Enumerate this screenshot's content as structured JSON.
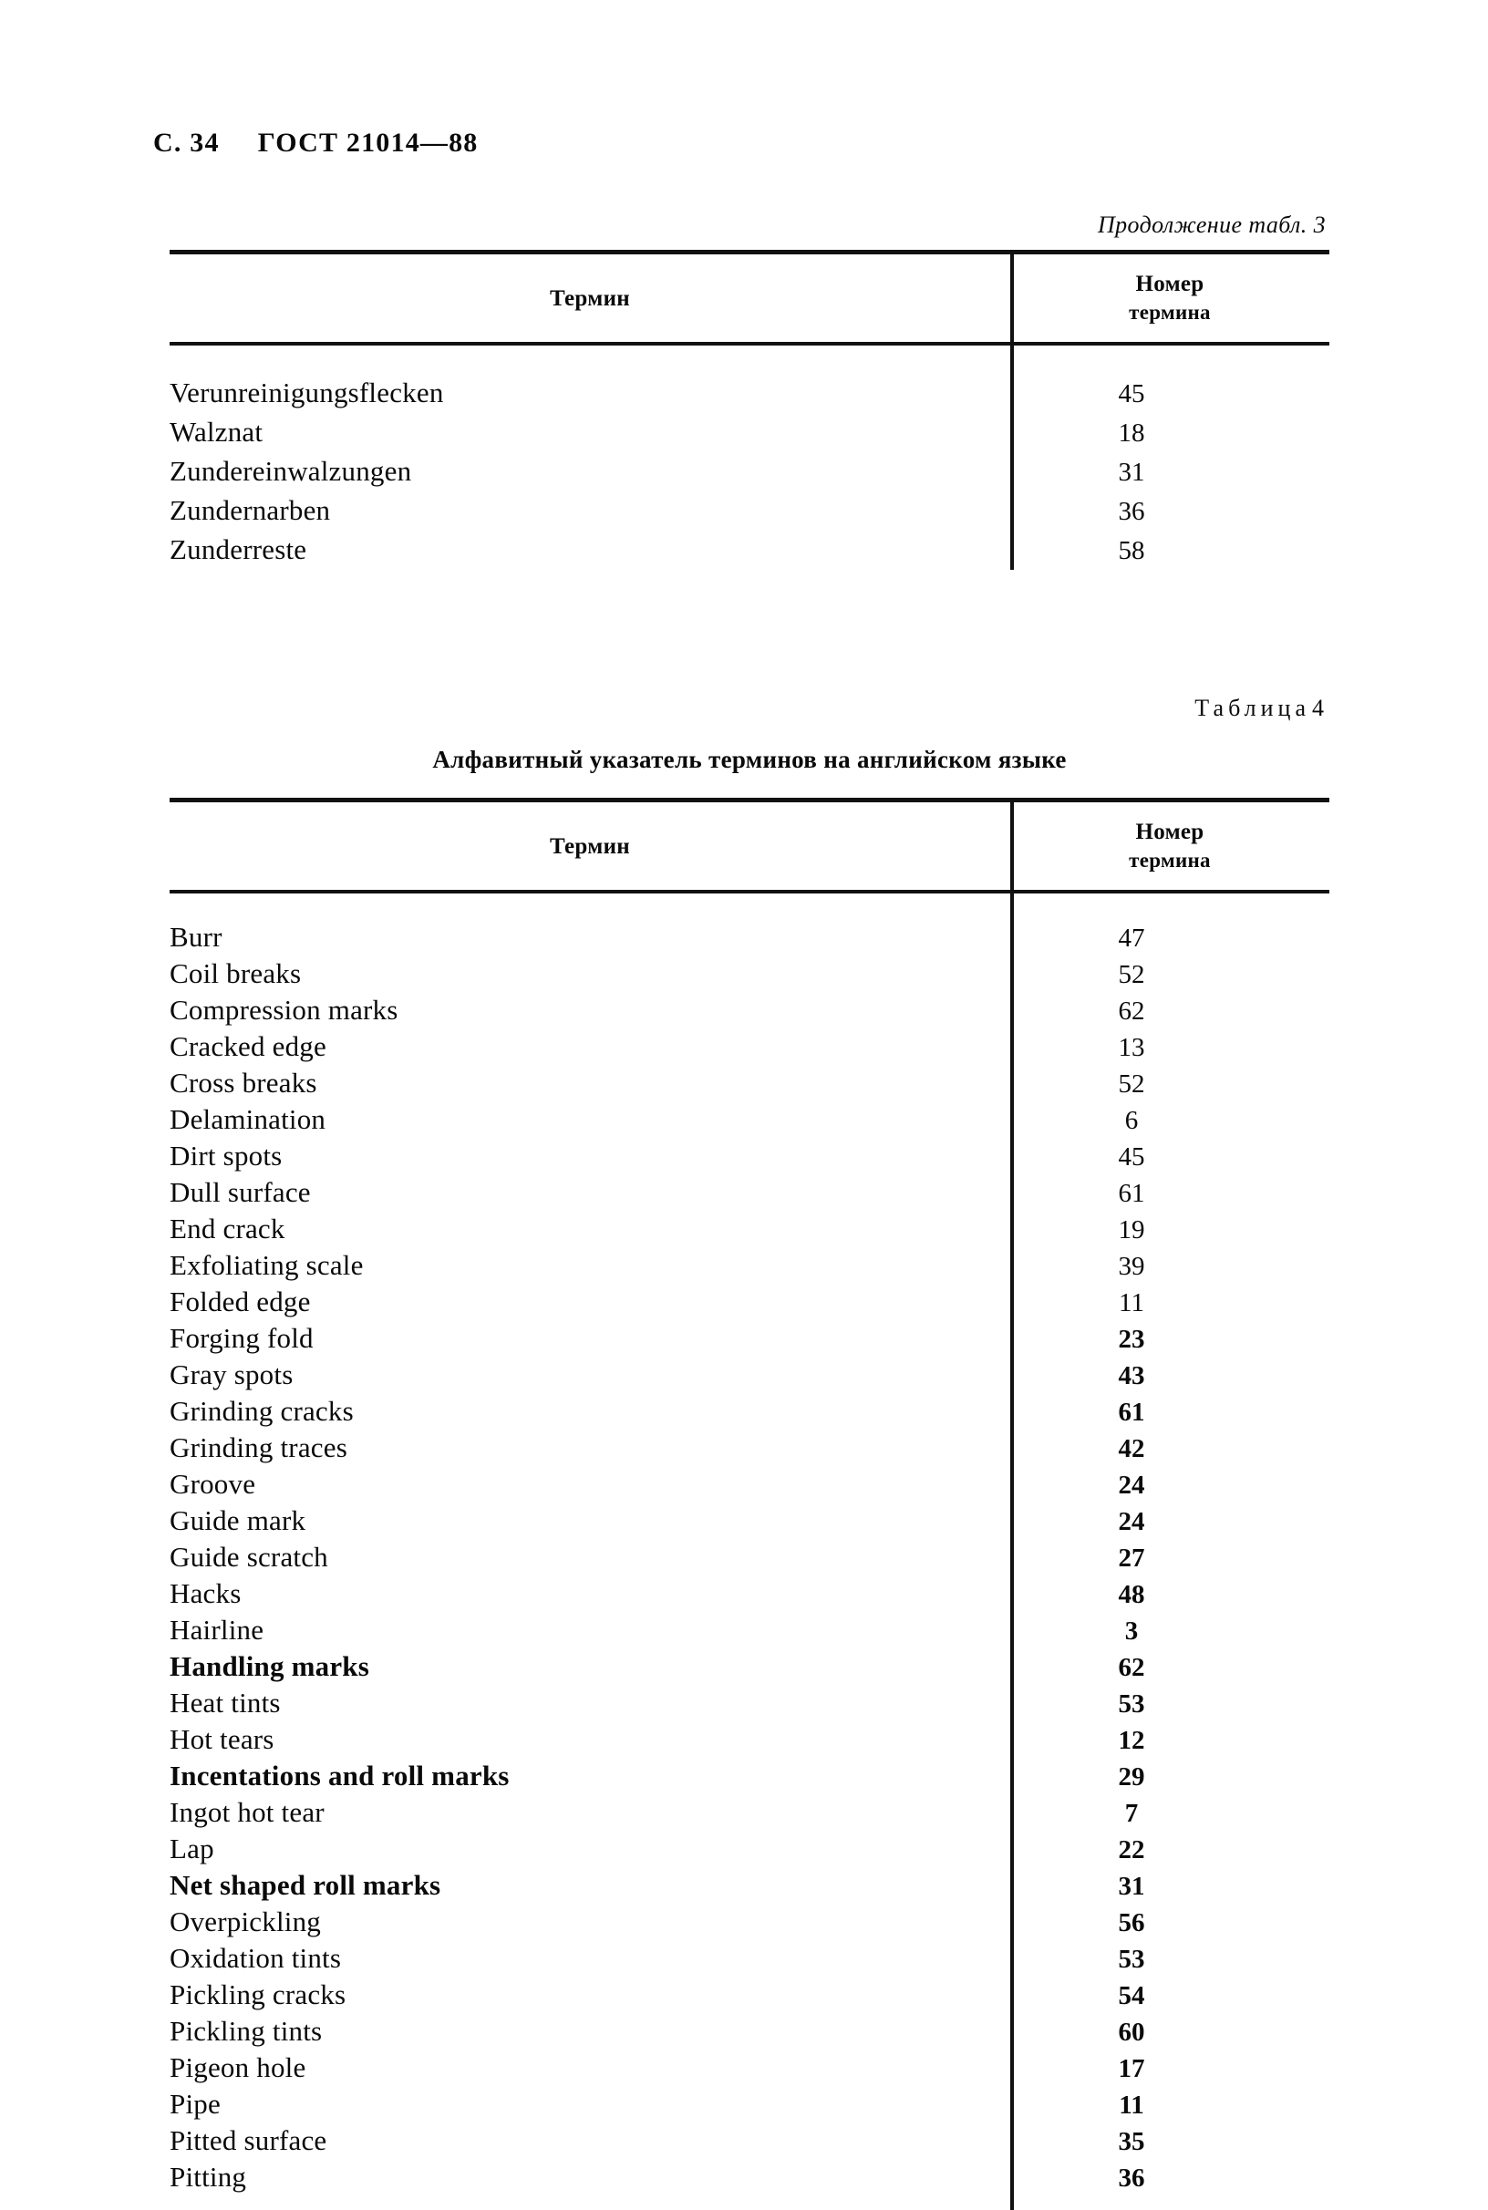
{
  "header": {
    "page_label": "С.",
    "page_number": "34",
    "standard": "ГОСТ 21014—88"
  },
  "table3": {
    "continuation_caption": "Продолжение табл. 3",
    "columns": {
      "term": "Термин",
      "number_line1": "Номер",
      "number_line2": "термина"
    },
    "rows": [
      {
        "term": "Verunreinigungsflecken",
        "number": "45"
      },
      {
        "term": "Walznat",
        "number": "18"
      },
      {
        "term": "Zundereinwalzungen",
        "number": "31"
      },
      {
        "term": "Zundernarben",
        "number": "36"
      },
      {
        "term": "Zunderreste",
        "number": "58"
      }
    ]
  },
  "table4": {
    "table_label": "Таблица",
    "table_number": "4",
    "title": "Алфавитный указатель терминов на английском языке",
    "columns": {
      "term": "Термин",
      "number_line1": "Номер",
      "number_line2": "термина"
    },
    "rows": [
      {
        "term": "Burr",
        "number": "47"
      },
      {
        "term": "Coil breaks",
        "number": "52"
      },
      {
        "term": "Compression marks",
        "number": "62"
      },
      {
        "term": "Cracked edge",
        "number": "13"
      },
      {
        "term": "Cross breaks",
        "number": "52"
      },
      {
        "term": "Delamination",
        "number": "6"
      },
      {
        "term": "Dirt spots",
        "number": "45"
      },
      {
        "term": "Dull surface",
        "number": "61"
      },
      {
        "term": "End crack",
        "number": "19"
      },
      {
        "term": "Exfoliating scale",
        "number": "39"
      },
      {
        "term": "Folded edge",
        "number": "11"
      },
      {
        "term": "Forging fold",
        "number": "23"
      },
      {
        "term": "Gray spots",
        "number": "43"
      },
      {
        "term": "Grinding cracks",
        "number": "61"
      },
      {
        "term": "Grinding traces",
        "number": "42"
      },
      {
        "term": "Groove",
        "number": "24"
      },
      {
        "term": "Guide mark",
        "number": "24"
      },
      {
        "term": "Guide scratch",
        "number": "27"
      },
      {
        "term": "Hacks",
        "number": "48"
      },
      {
        "term": "Hairline",
        "number": "3"
      },
      {
        "term": "Handling marks",
        "number": "62"
      },
      {
        "term": "Heat tints",
        "number": "53"
      },
      {
        "term": "Hot tears",
        "number": "12"
      },
      {
        "term": "Incentations and roll marks",
        "number": "29"
      },
      {
        "term": "Ingot hot tear",
        "number": "7"
      },
      {
        "term": "Lap",
        "number": "22"
      },
      {
        "term": "Net shaped roll marks",
        "number": "31"
      },
      {
        "term": "Overpickling",
        "number": "56"
      },
      {
        "term": "Oxidation tints",
        "number": "53"
      },
      {
        "term": "Pickling cracks",
        "number": "54"
      },
      {
        "term": "Pickling tints",
        "number": "60"
      },
      {
        "term": "Pigeon hole",
        "number": "17"
      },
      {
        "term": "Pipe",
        "number": "11"
      },
      {
        "term": "Pitted surface",
        "number": "35"
      },
      {
        "term": "Pitting",
        "number": "36"
      }
    ]
  }
}
